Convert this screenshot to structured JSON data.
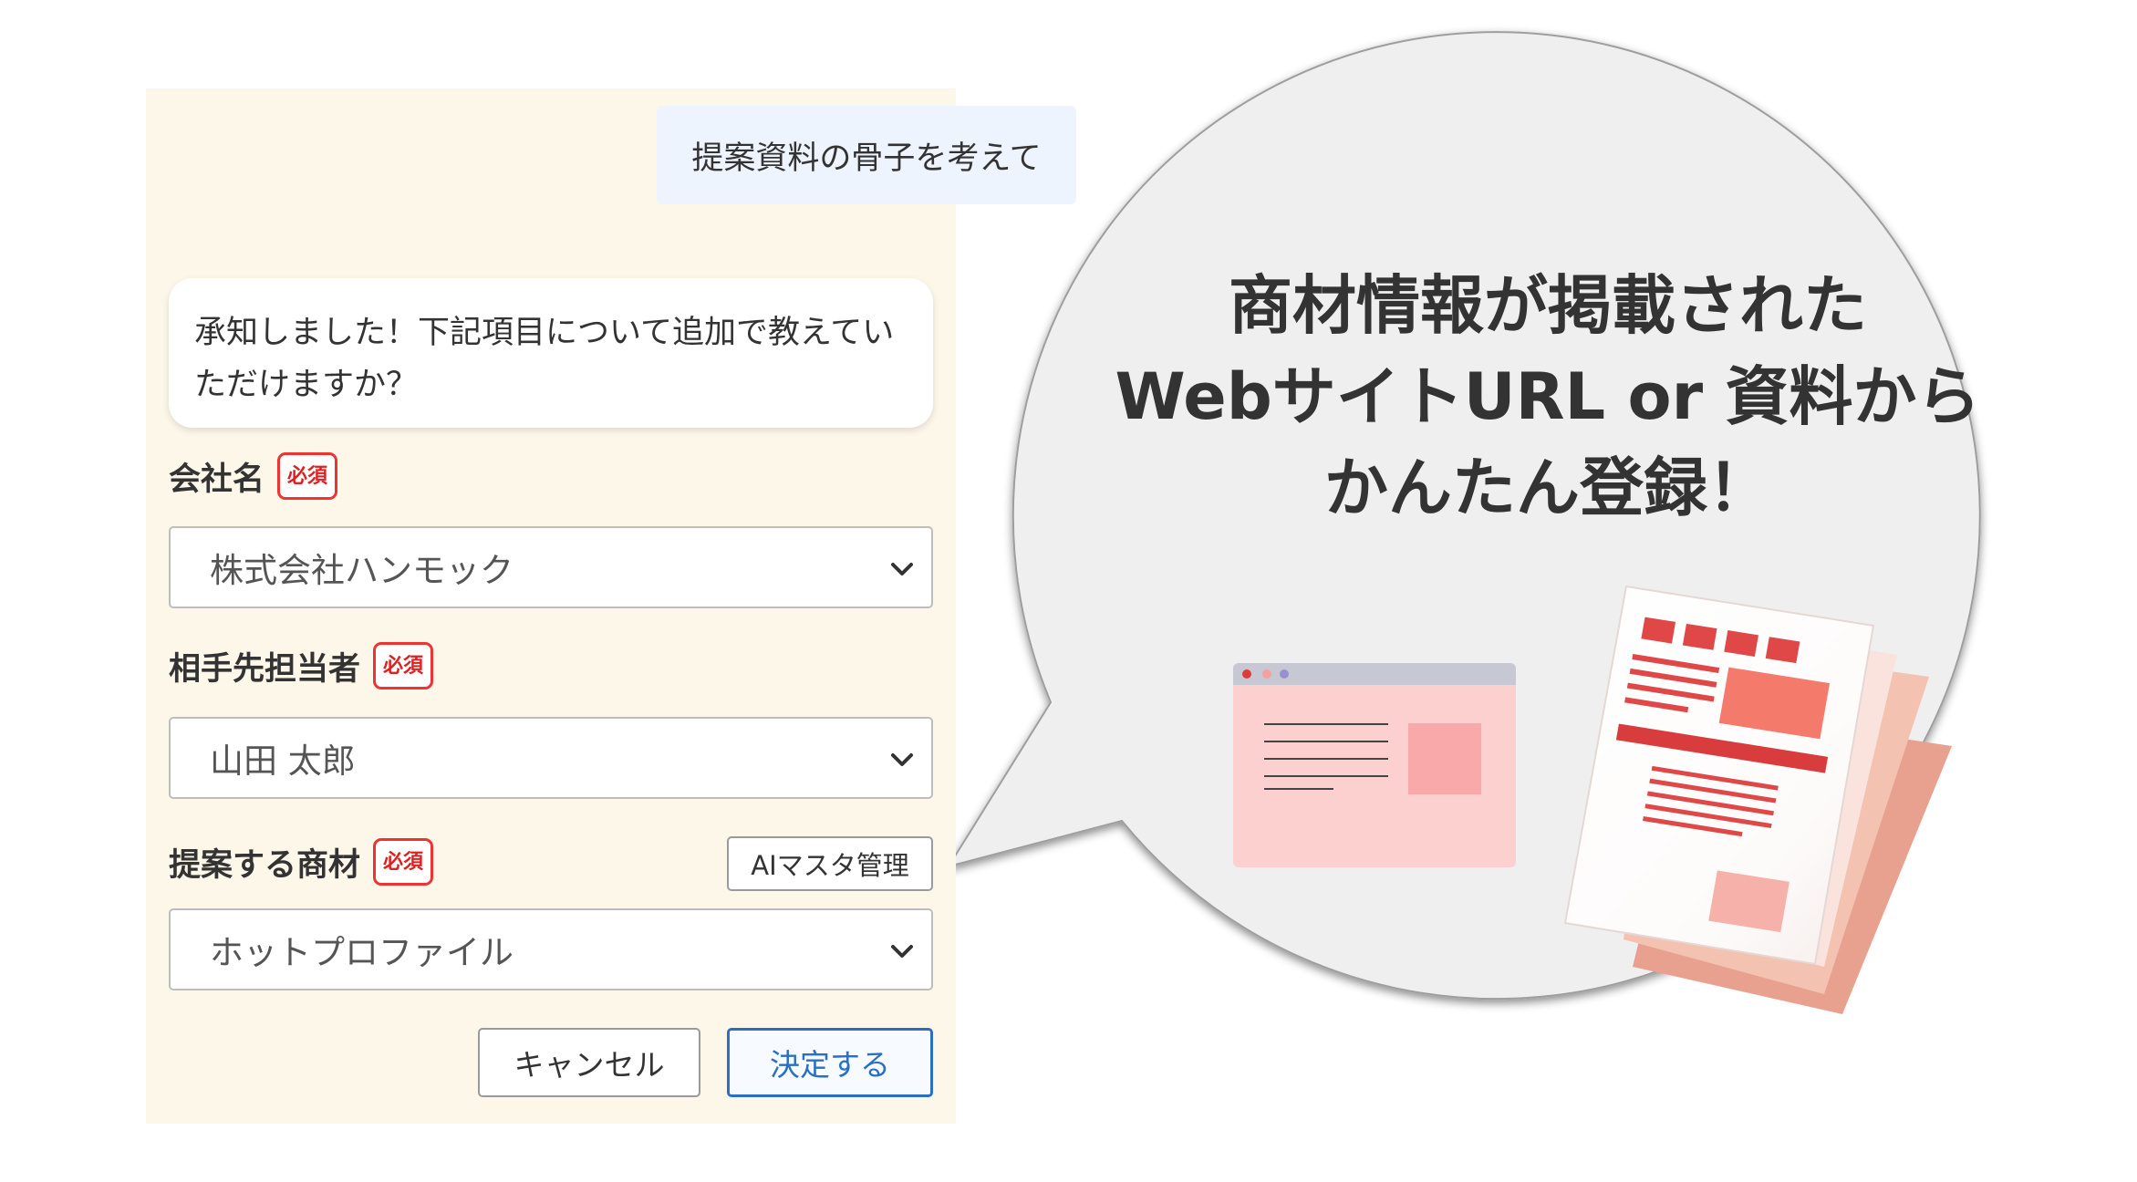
{
  "chat": {
    "user_message": "提案資料の骨子を考えて",
    "bot_message": "承知しました！下記項目について追加で教えていただけますか？"
  },
  "form": {
    "required_badge": "必須",
    "company": {
      "label": "会社名",
      "value": "株式会社ハンモック"
    },
    "contact": {
      "label": "相手先担当者",
      "value": "山田 太郎"
    },
    "product": {
      "label": "提案する商材",
      "value": "ホットプロファイル",
      "ai_button": "AIマスタ管理"
    },
    "cancel_label": "キャンセル",
    "confirm_label": "決定する"
  },
  "callout": {
    "line1": "商材情報が掲載された",
    "line2": "WebサイトURL or 資料から",
    "line3": "かんたん登録！"
  },
  "icons": {
    "browser": "browser-window-icon",
    "documents": "document-stack-icon",
    "dropdown": "chevron-down-icon"
  },
  "colors": {
    "panel_bg": "#fdf7e9",
    "user_bubble": "#eef4fd",
    "required": "#e02020",
    "primary": "#2a6fc4",
    "callout_bg": "#efefef",
    "illustration_red": "#e04848"
  }
}
